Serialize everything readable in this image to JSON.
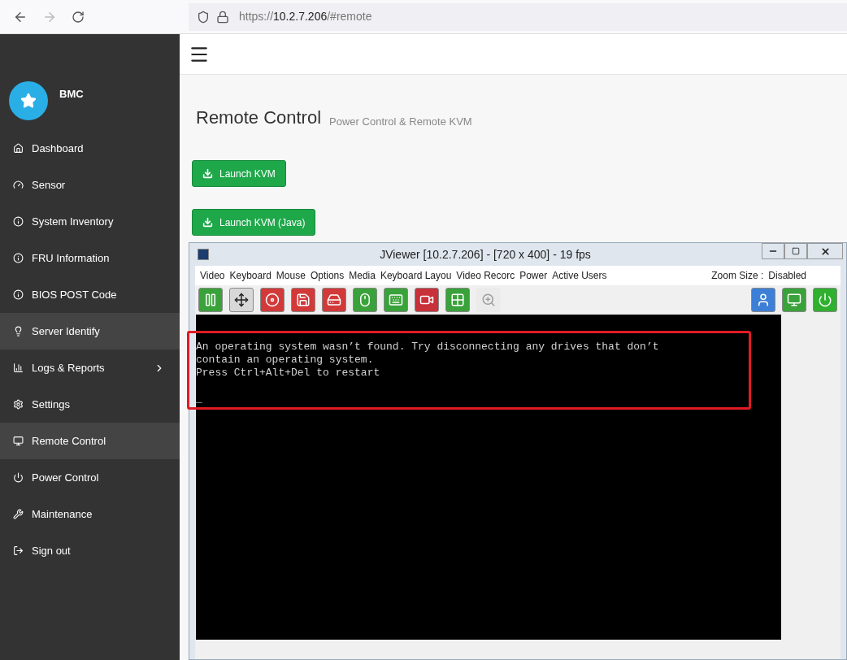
{
  "browser": {
    "url_prefix": "https://",
    "url_host": "10.2.7.206",
    "url_path": "/#remote"
  },
  "sidebar": {
    "brand": "BMC",
    "items": [
      {
        "label": "Dashboard",
        "selected": false,
        "has_submenu": false
      },
      {
        "label": "Sensor",
        "selected": false,
        "has_submenu": false
      },
      {
        "label": "System Inventory",
        "selected": false,
        "has_submenu": false
      },
      {
        "label": "FRU Information",
        "selected": false,
        "has_submenu": false
      },
      {
        "label": "BIOS POST Code",
        "selected": false,
        "has_submenu": false
      },
      {
        "label": "Server Identify",
        "selected": true,
        "has_submenu": false
      },
      {
        "label": "Logs & Reports",
        "selected": false,
        "has_submenu": true
      },
      {
        "label": "Settings",
        "selected": false,
        "has_submenu": false
      },
      {
        "label": "Remote Control",
        "selected": true,
        "has_submenu": false
      },
      {
        "label": "Power Control",
        "selected": false,
        "has_submenu": false
      },
      {
        "label": "Maintenance",
        "selected": false,
        "has_submenu": false
      },
      {
        "label": "Sign out",
        "selected": false,
        "has_submenu": false
      }
    ]
  },
  "page": {
    "title": "Remote Control",
    "subtitle": "Power Control & Remote KVM",
    "buttons": [
      "Launch KVM",
      "Launch KVM (Java)"
    ]
  },
  "jviewer": {
    "title": "JViewer [10.2.7.206] - [720 x 400] - 19 fps",
    "menu": [
      "Video",
      "Keyboard",
      "Mouse",
      "Options",
      "Media",
      "Keyboard Layou",
      "Video Recorc",
      "Power",
      "Active Users"
    ],
    "zoom_label": "Zoom Size :",
    "zoom_value": "Disabled",
    "toolbar": [
      {
        "kind": "pause",
        "disabled": false
      },
      {
        "kind": "fullscreen",
        "disabled": false
      },
      {
        "kind": "cd",
        "disabled": false
      },
      {
        "kind": "floppy",
        "disabled": false
      },
      {
        "kind": "drive",
        "disabled": false
      },
      {
        "kind": "mouse",
        "disabled": false
      },
      {
        "kind": "keyboard",
        "disabled": false
      },
      {
        "kind": "record",
        "disabled": false
      },
      {
        "kind": "hotkeys",
        "disabled": false
      },
      {
        "kind": "zoom",
        "disabled": true
      },
      {
        "kind": "user",
        "disabled": false
      },
      {
        "kind": "display",
        "disabled": false
      },
      {
        "kind": "power",
        "disabled": false
      }
    ],
    "console_lines": [
      "An operating system wasn’t found. Try disconnecting any drives that don’t",
      "contain an operating system.",
      "Press Ctrl+Alt+Del to restart",
      "_"
    ]
  }
}
